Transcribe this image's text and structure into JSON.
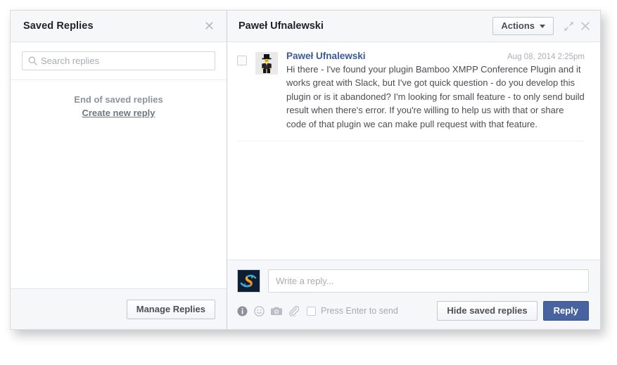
{
  "saved_replies_panel": {
    "title": "Saved Replies",
    "close_icon": "close-icon",
    "search": {
      "placeholder": "Search replies",
      "value": "",
      "icon": "search-icon"
    },
    "empty_state": {
      "end_text": "End of saved replies",
      "create_link": "Create new reply"
    },
    "footer": {
      "manage_button": "Manage Replies"
    }
  },
  "conversation": {
    "title": "Paweł Ufnalewski",
    "actions_button": "Actions",
    "expand_icon": "expand-icon",
    "close_icon": "close-icon",
    "messages": [
      {
        "author": "Paweł Ufnalewski",
        "timestamp": "Aug 08, 2014 2:25pm",
        "avatar": "lego-minifigure-avatar",
        "body": "Hi there - I've found your plugin Bamboo XMPP Conference Plugin and it works great with Slack, but I've got quick question - do you develop this plugin or is it abandoned? I'm looking for small feature - to only send build result when there's error. If you're willing to help us with that or share code of that plugin we can make pull request with that feature."
      }
    ]
  },
  "composer": {
    "account_avatar": "s-logo-avatar",
    "input": {
      "placeholder": "Write a reply...",
      "value": ""
    },
    "tools": [
      {
        "icon": "info-icon",
        "label": "Info"
      },
      {
        "icon": "emoji-icon",
        "label": "Emoji"
      },
      {
        "icon": "camera-icon",
        "label": "Camera"
      },
      {
        "icon": "attachment-icon",
        "label": "Attachment"
      }
    ],
    "enter_to_send": {
      "label": "Press Enter to send",
      "checked": false
    },
    "hide_saved_replies_button": "Hide saved replies",
    "reply_button": "Reply"
  },
  "colors": {
    "accent_blue": "#4962a0",
    "author_blue": "#3b5998",
    "header_bg": "#f6f7f9",
    "border": "#e3e5e9",
    "muted_text": "#a9aeb6"
  }
}
